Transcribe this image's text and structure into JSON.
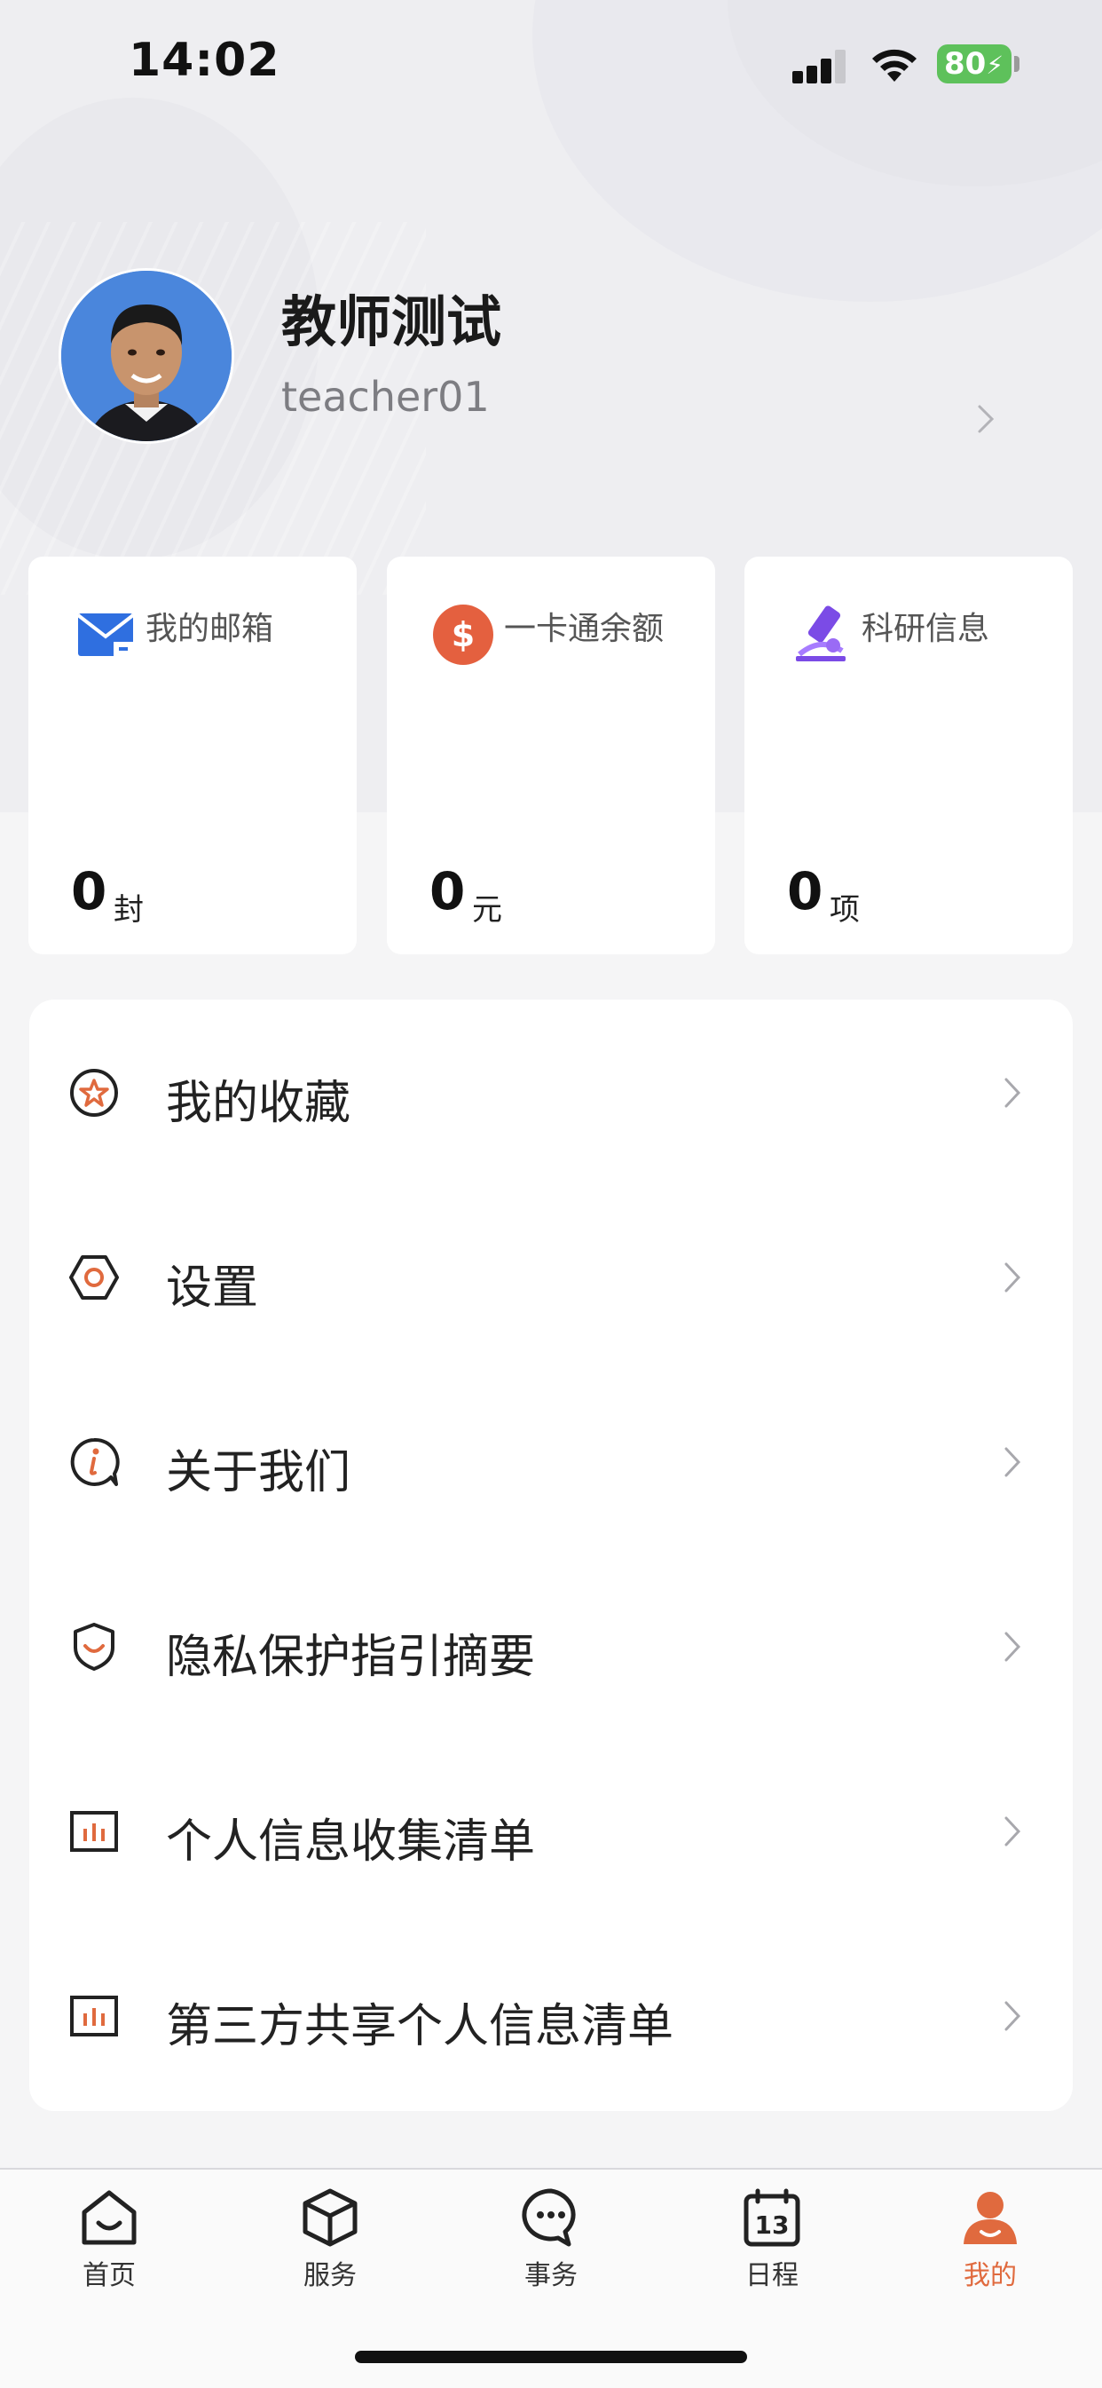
{
  "status_bar": {
    "time": "14:02",
    "battery": "80"
  },
  "profile": {
    "name": "教师测试",
    "username": "teacher01"
  },
  "cards": [
    {
      "label": "我的邮箱",
      "value": "0",
      "unit": "封",
      "icon": "mail-icon"
    },
    {
      "label": "一卡通余额",
      "value": "0",
      "unit": "元",
      "icon": "dollar-coin-icon"
    },
    {
      "label": "科研信息",
      "value": "0",
      "unit": "项",
      "icon": "microscope-icon"
    }
  ],
  "menu": [
    {
      "label": "我的收藏",
      "icon": "star-badge-icon"
    },
    {
      "label": "设置",
      "icon": "hexagon-settings-icon"
    },
    {
      "label": "关于我们",
      "icon": "info-bubble-icon"
    },
    {
      "label": "隐私保护指引摘要",
      "icon": "shield-icon"
    },
    {
      "label": "个人信息收集清单",
      "icon": "bar-chart-icon"
    },
    {
      "label": "第三方共享个人信息清单",
      "icon": "bar-chart-icon"
    }
  ],
  "tabs": [
    {
      "label": "首页",
      "icon": "home-icon",
      "active": false
    },
    {
      "label": "服务",
      "icon": "cube-icon",
      "active": false
    },
    {
      "label": "事务",
      "icon": "chat-icon",
      "active": false
    },
    {
      "label": "日程",
      "icon": "calendar-icon",
      "active": false
    },
    {
      "label": "我的",
      "icon": "person-icon",
      "active": true
    }
  ],
  "colors": {
    "accent": "#e06a3e",
    "mail_blue": "#2f6fe0",
    "research_purple": "#7b4be6"
  }
}
